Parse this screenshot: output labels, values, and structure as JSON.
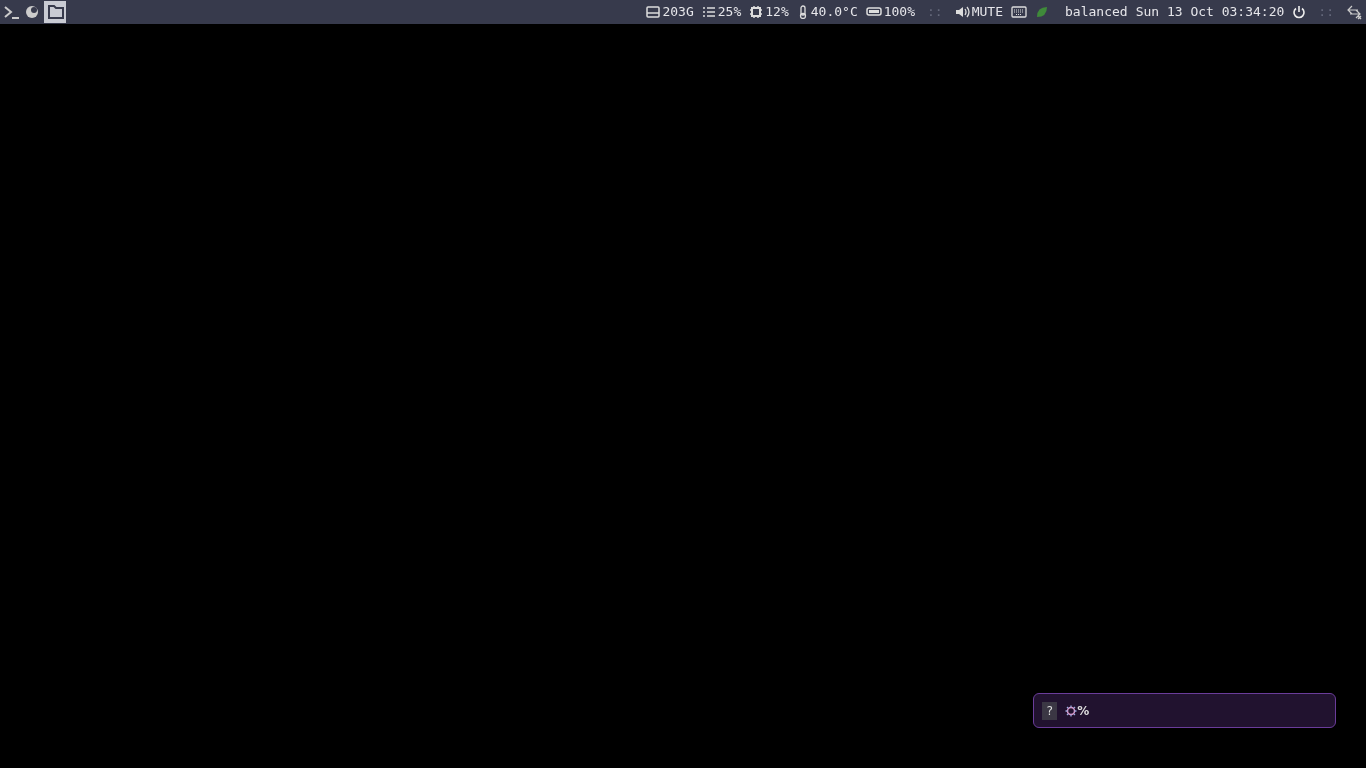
{
  "left_icons": [
    {
      "kind": "terminal"
    },
    {
      "kind": "moon"
    },
    {
      "kind": "folder",
      "selected": true
    }
  ],
  "status": [
    {
      "kind": "disk",
      "text": "203G"
    },
    {
      "kind": "memory",
      "text": "25%"
    },
    {
      "kind": "cpu",
      "text": "12%"
    },
    {
      "kind": "temp",
      "text": "40.0°C"
    },
    {
      "kind": "battery",
      "text": "100%"
    },
    {
      "kind": "sep",
      "text": "::"
    },
    {
      "kind": "volume",
      "text": "MUTE"
    },
    {
      "kind": "keyboard"
    },
    {
      "kind": "leaf",
      "text": "balanced"
    },
    {
      "kind": "clock",
      "text": "Sun 13 Oct 03:34:20"
    },
    {
      "kind": "power"
    },
    {
      "kind": "sep",
      "text": "::"
    },
    {
      "kind": "network"
    }
  ],
  "notification": {
    "badge": "?",
    "text": "%"
  }
}
